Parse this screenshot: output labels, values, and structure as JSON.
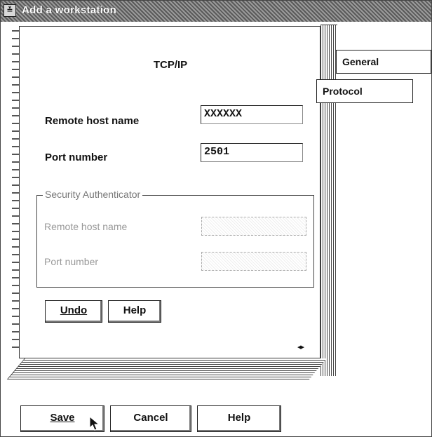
{
  "window": {
    "title": "Add a workstation",
    "sysmenu_glyph": "≚"
  },
  "tabs": [
    {
      "label": "General",
      "selected": false
    },
    {
      "label": "Protocol",
      "selected": true
    }
  ],
  "page": {
    "title": "TCP/IP",
    "remote_host": {
      "label": "Remote host name",
      "value": "XXXXXX"
    },
    "port": {
      "label": "Port number",
      "value": "2501"
    },
    "security": {
      "legend": "Security Authenticator",
      "remote_host_label": "Remote host name",
      "remote_host_value": "",
      "port_label": "Port number",
      "port_value": ""
    },
    "undo_label": "Undo",
    "help_label": "Help",
    "page_arrows": "◂▸"
  },
  "footer": {
    "save_label": "Save",
    "cancel_label": "Cancel",
    "help_label": "Help"
  },
  "icons": {
    "sysmenu": "system-menu-icon",
    "page_arrows": "page-navigation-icon",
    "cursor": "mouse-pointer-icon"
  }
}
